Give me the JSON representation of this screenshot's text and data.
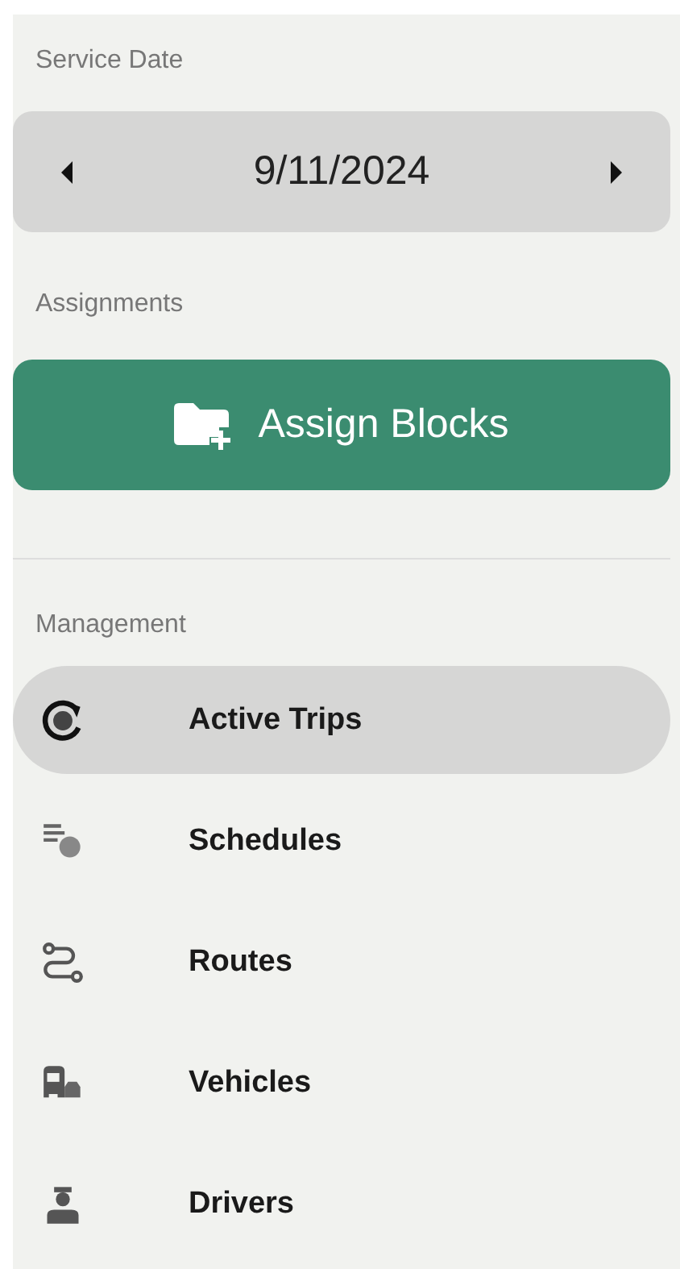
{
  "service_date": {
    "label": "Service Date",
    "value": "9/11/2024"
  },
  "assignments": {
    "label": "Assignments",
    "button": "Assign Blocks"
  },
  "management": {
    "label": "Management",
    "items": [
      {
        "kind": "trips",
        "label": "Active Trips",
        "selected": true
      },
      {
        "kind": "schedules",
        "label": "Schedules",
        "selected": false
      },
      {
        "kind": "routes",
        "label": "Routes",
        "selected": false
      },
      {
        "kind": "vehicles",
        "label": "Vehicles",
        "selected": false
      },
      {
        "kind": "drivers",
        "label": "Drivers",
        "selected": false
      }
    ]
  }
}
